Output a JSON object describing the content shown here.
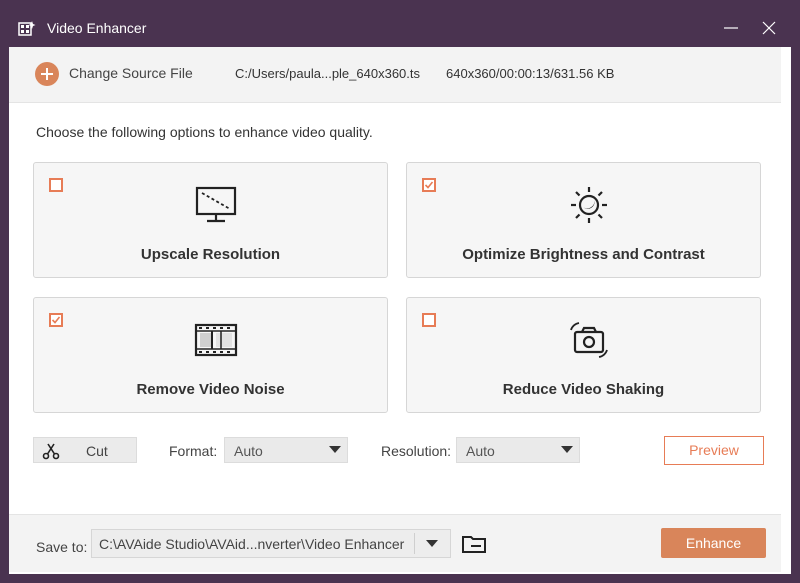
{
  "window": {
    "title": "Video Enhancer"
  },
  "source": {
    "change_label": "Change Source File",
    "path": "C:/Users/paula...ple_640x360.ts",
    "info": "640x360/00:00:13/631.56 KB"
  },
  "instruction": "Choose the following options to enhance video quality.",
  "options": [
    {
      "label": "Upscale Resolution",
      "checked": false,
      "icon": "monitor-icon"
    },
    {
      "label": "Optimize Brightness and Contrast",
      "checked": true,
      "icon": "brightness-icon"
    },
    {
      "label": "Remove Video Noise",
      "checked": true,
      "icon": "film-icon"
    },
    {
      "label": "Reduce Video Shaking",
      "checked": false,
      "icon": "camera-stabilize-icon"
    }
  ],
  "toolbar": {
    "cut_label": "Cut",
    "format_label": "Format:",
    "format_value": "Auto",
    "resolution_label": "Resolution:",
    "resolution_value": "Auto",
    "preview_label": "Preview"
  },
  "footer": {
    "save_label": "Save to:",
    "save_path": "C:\\AVAide Studio\\AVAid...nverter\\Video Enhancer",
    "enhance_label": "Enhance"
  },
  "colors": {
    "titlebar": "#4a3350",
    "accent": "#e77c56",
    "enhance_button": "#d9855a"
  }
}
